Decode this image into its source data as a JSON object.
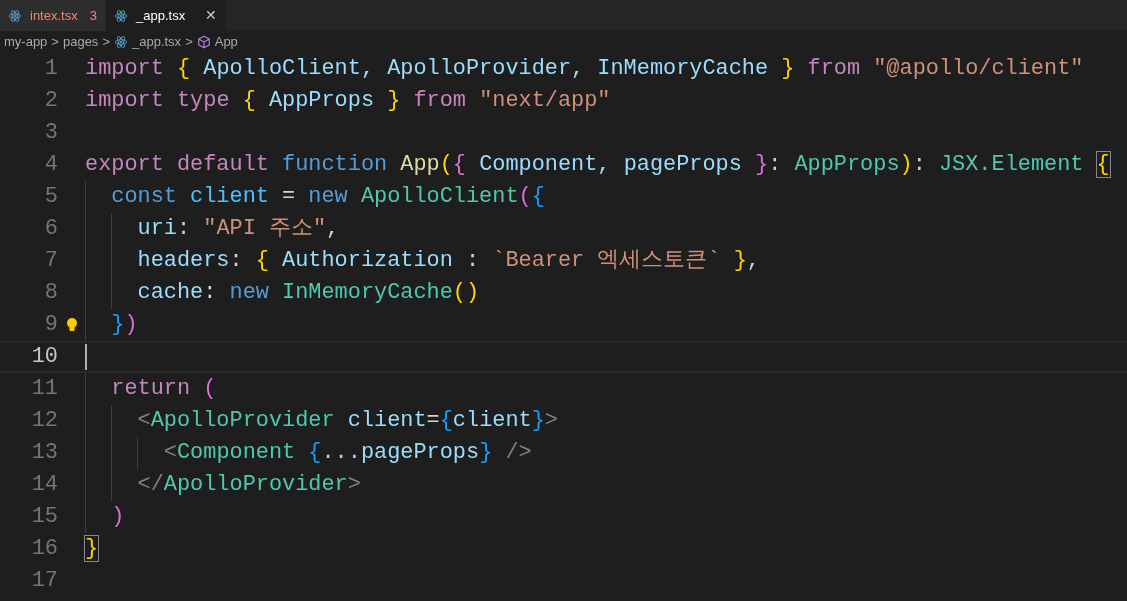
{
  "tabs": [
    {
      "label": "intex.tsx",
      "problems": "3",
      "has_errors": true,
      "selected": false
    },
    {
      "label": "_app.tsx",
      "close": "✕",
      "has_errors": false,
      "selected": true
    }
  ],
  "breadcrumb": [
    {
      "label": "my-app",
      "kind": "folder"
    },
    {
      "label": "pages",
      "kind": "folder"
    },
    {
      "label": "_app.tsx",
      "kind": "file"
    },
    {
      "label": "App",
      "kind": "symbol"
    }
  ],
  "breadcrumb_separator": ">",
  "lines": [
    {
      "number": "1",
      "current": false,
      "lightbulb": false,
      "tokens": [
        {
          "text": "import ",
          "kind": "keyword"
        },
        {
          "text": "{",
          "kind": "b1"
        },
        {
          "text": " ApolloClient, ApolloProvider, InMemoryCache ",
          "kind": "var"
        },
        {
          "text": "}",
          "kind": "b1"
        },
        {
          "text": " from ",
          "kind": "keyword"
        },
        {
          "text": "\"@apollo/client\"",
          "kind": "string"
        }
      ]
    },
    {
      "number": "2",
      "current": false,
      "lightbulb": false,
      "tokens": [
        {
          "text": "import ",
          "kind": "keyword"
        },
        {
          "text": "type ",
          "kind": "keyword"
        },
        {
          "text": "{",
          "kind": "b1"
        },
        {
          "text": " AppProps ",
          "kind": "var"
        },
        {
          "text": "}",
          "kind": "b1"
        },
        {
          "text": " from ",
          "kind": "keyword"
        },
        {
          "text": "\"next/app\"",
          "kind": "string"
        }
      ]
    },
    {
      "number": "3",
      "current": false,
      "lightbulb": false
    },
    {
      "number": "4",
      "current": false,
      "lightbulb": false,
      "tokens": [
        {
          "text": "export default ",
          "kind": "keyword"
        },
        {
          "text": "function ",
          "kind": "storage"
        },
        {
          "text": "App",
          "kind": "func"
        },
        {
          "text": "(",
          "kind": "b1"
        },
        {
          "text": "{",
          "kind": "b2"
        },
        {
          "text": " Component, pageProps ",
          "kind": "var"
        },
        {
          "text": "}",
          "kind": "b2"
        },
        {
          "text": ": ",
          "kind": "plain"
        },
        {
          "text": "AppProps",
          "kind": "type"
        },
        {
          "text": ")",
          "kind": "b1"
        },
        {
          "text": ": ",
          "kind": "plain"
        },
        {
          "text": "JSX.Element ",
          "kind": "type"
        },
        {
          "text": "{",
          "kind": "match"
        }
      ]
    },
    {
      "number": "5",
      "current": false,
      "lightbulb": false,
      "tokens": [
        {
          "text": "  const ",
          "kind": "storage"
        },
        {
          "text": "client",
          "kind": "const"
        },
        {
          "text": " = ",
          "kind": "plain"
        },
        {
          "text": "new ",
          "kind": "storage"
        },
        {
          "text": "ApolloClient",
          "kind": "type"
        },
        {
          "text": "(",
          "kind": "b2"
        },
        {
          "text": "{",
          "kind": "b3"
        }
      ]
    },
    {
      "number": "6",
      "current": false,
      "lightbulb": false,
      "tokens": [
        {
          "text": "    uri",
          "kind": "var"
        },
        {
          "text": ": ",
          "kind": "plain"
        },
        {
          "text": "\"API 주소\"",
          "kind": "string"
        },
        {
          "text": ",",
          "kind": "plain"
        }
      ]
    },
    {
      "number": "7",
      "current": false,
      "lightbulb": false,
      "tokens": [
        {
          "text": "    headers",
          "kind": "var"
        },
        {
          "text": ": ",
          "kind": "plain"
        },
        {
          "text": "{",
          "kind": "b1"
        },
        {
          "text": " Authorization ",
          "kind": "var"
        },
        {
          "text": ": ",
          "kind": "plain"
        },
        {
          "text": "`Bearer 엑세스토큰` ",
          "kind": "string"
        },
        {
          "text": "}",
          "kind": "b1"
        },
        {
          "text": ",",
          "kind": "plain"
        }
      ]
    },
    {
      "number": "8",
      "current": false,
      "lightbulb": false,
      "tokens": [
        {
          "text": "    cache",
          "kind": "var"
        },
        {
          "text": ": ",
          "kind": "plain"
        },
        {
          "text": "new ",
          "kind": "storage"
        },
        {
          "text": "InMemoryCache",
          "kind": "type"
        },
        {
          "text": "()",
          "kind": "b1"
        }
      ]
    },
    {
      "number": "9",
      "current": false,
      "lightbulb": true,
      "tokens": [
        {
          "text": "  }",
          "kind": "b3"
        },
        {
          "text": ")",
          "kind": "b2"
        }
      ]
    },
    {
      "number": "10",
      "current": true,
      "lightbulb": false
    },
    {
      "number": "11",
      "current": false,
      "lightbulb": false,
      "tokens": [
        {
          "text": "  return ",
          "kind": "keyword"
        },
        {
          "text": "(",
          "kind": "b2"
        }
      ]
    },
    {
      "number": "12",
      "current": false,
      "lightbulb": false,
      "tokens": [
        {
          "text": "    <",
          "kind": "punct"
        },
        {
          "text": "ApolloProvider ",
          "kind": "type"
        },
        {
          "text": "client",
          "kind": "var"
        },
        {
          "text": "=",
          "kind": "plain"
        },
        {
          "text": "{",
          "kind": "b3"
        },
        {
          "text": "client",
          "kind": "var"
        },
        {
          "text": "}",
          "kind": "b3"
        },
        {
          "text": ">",
          "kind": "punct"
        }
      ]
    },
    {
      "number": "13",
      "current": false,
      "lightbulb": false,
      "tokens": [
        {
          "text": "      <",
          "kind": "punct"
        },
        {
          "text": "Component ",
          "kind": "type"
        },
        {
          "text": "{",
          "kind": "b3"
        },
        {
          "text": "...pageProps",
          "kind": "var"
        },
        {
          "text": "}",
          "kind": "b3"
        },
        {
          "text": " />",
          "kind": "punct"
        }
      ]
    },
    {
      "number": "14",
      "current": false,
      "lightbulb": false,
      "tokens": [
        {
          "text": "    </",
          "kind": "punct"
        },
        {
          "text": "ApolloProvider",
          "kind": "type"
        },
        {
          "text": ">",
          "kind": "punct"
        }
      ]
    },
    {
      "number": "15",
      "current": false,
      "lightbulb": false,
      "tokens": [
        {
          "text": "  )",
          "kind": "b2"
        }
      ]
    },
    {
      "number": "16",
      "current": false,
      "lightbulb": false,
      "tokens": [
        {
          "text": "}",
          "kind": "match"
        }
      ]
    },
    {
      "number": "17",
      "current": false,
      "lightbulb": false
    }
  ]
}
